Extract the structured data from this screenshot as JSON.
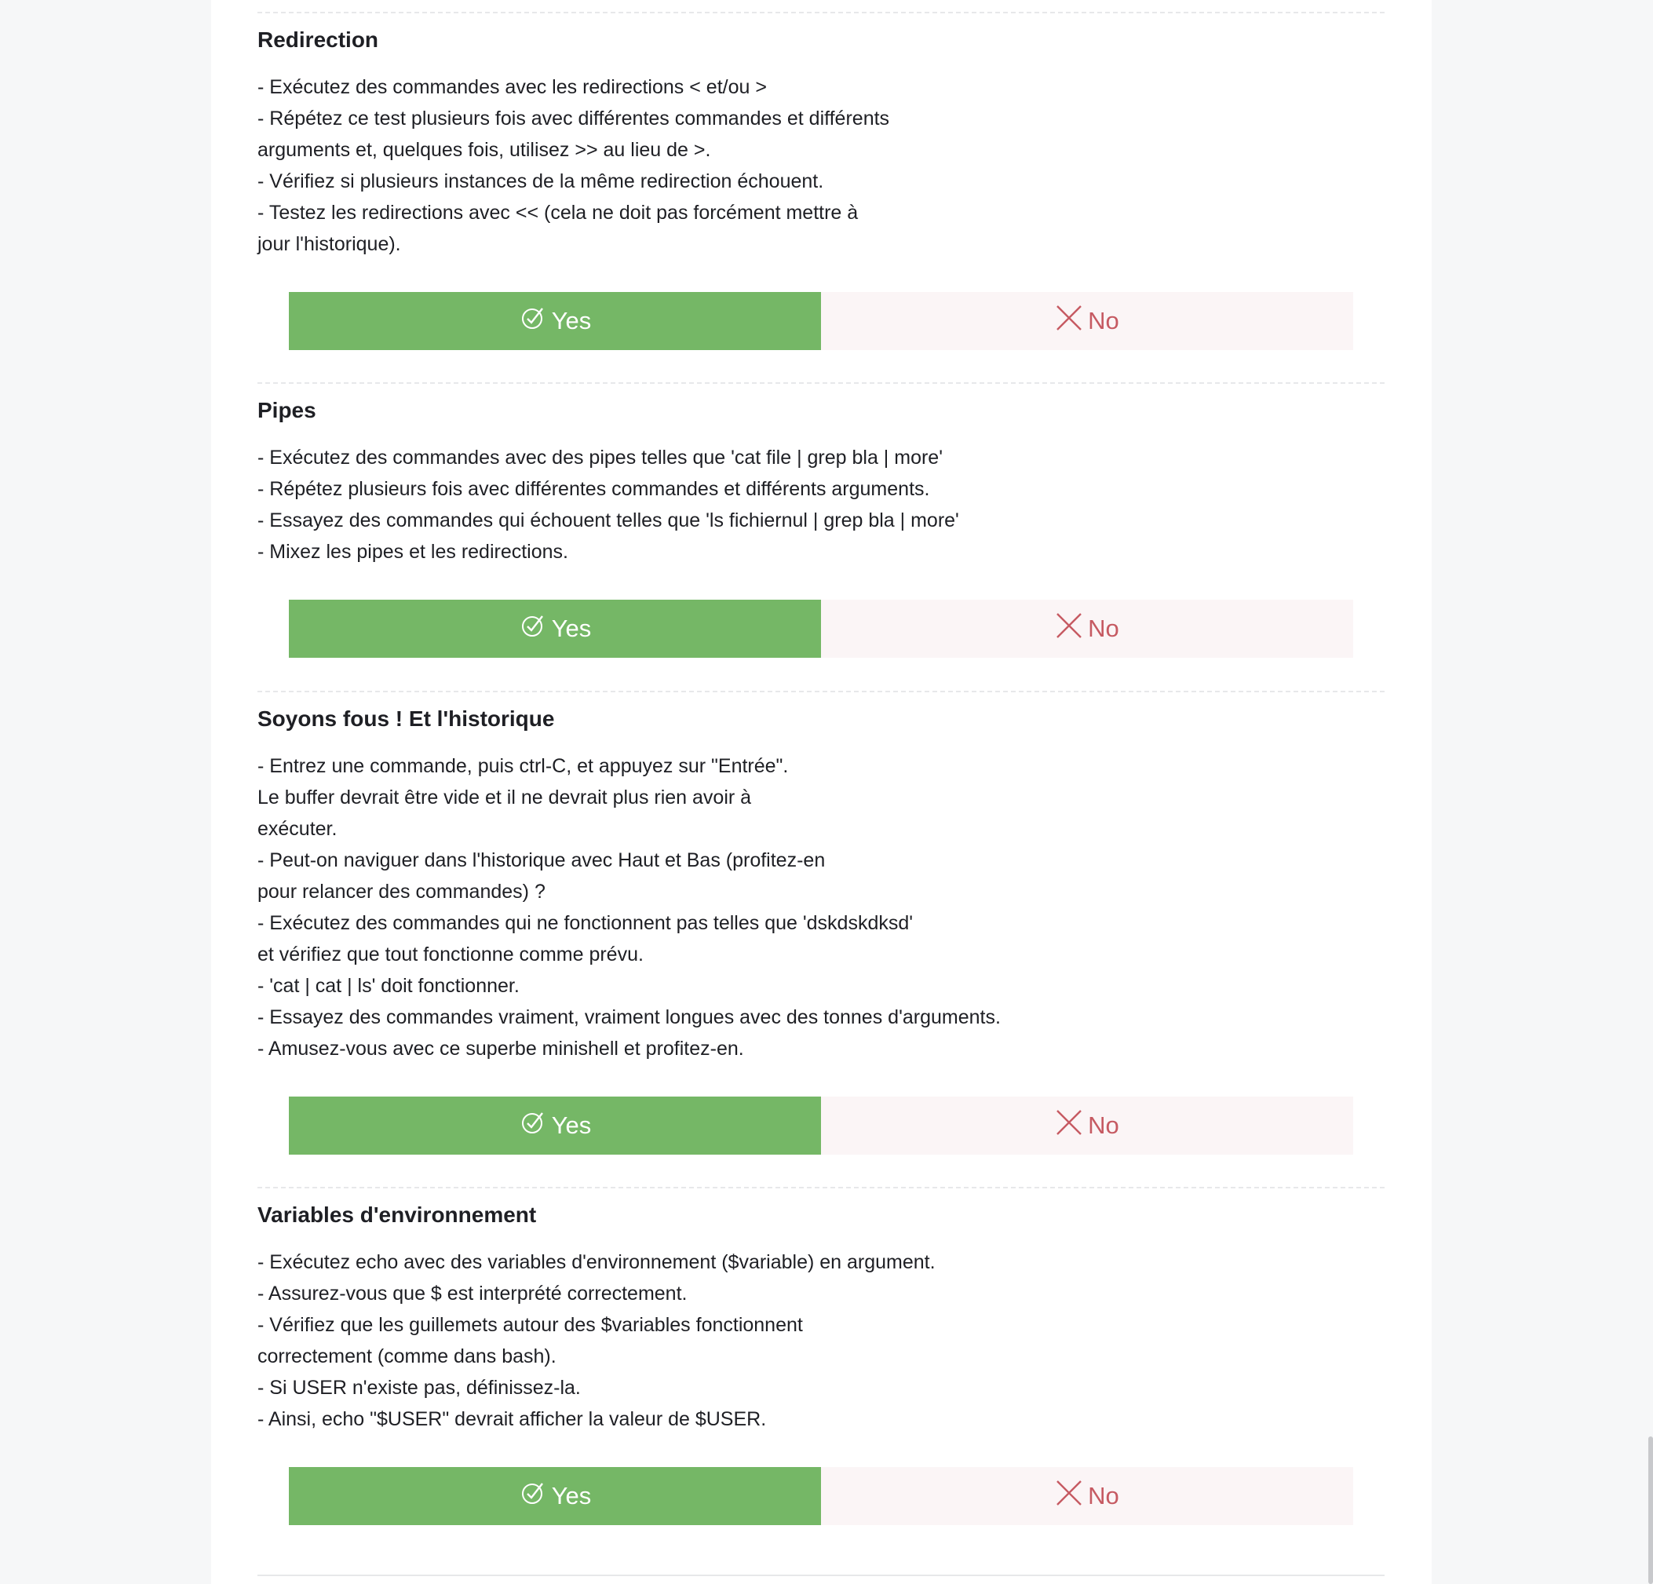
{
  "sections": [
    {
      "title": "Redirection",
      "description": "- Exécutez des commandes avec les redirections < et/ou >\n- Répétez ce test plusieurs fois avec différentes commandes et différents\narguments et, quelques fois, utilisez >> au lieu de >.\n- Vérifiez si plusieurs instances de la même redirection échouent.\n- Testez les redirections avec << (cela ne doit pas forcément mettre à\njour l'historique).",
      "yes_label": "Yes",
      "no_label": "No"
    },
    {
      "title": "Pipes",
      "description": "- Exécutez des commandes avec des pipes telles que 'cat file | grep bla | more'\n- Répétez plusieurs fois avec différentes commandes et différents arguments.\n- Essayez des commandes qui échouent telles que 'ls fichiernul | grep bla | more'\n- Mixez les pipes et les redirections.",
      "yes_label": "Yes",
      "no_label": "No"
    },
    {
      "title": "Soyons fous ! Et l'historique",
      "description": "- Entrez une commande, puis ctrl-C, et appuyez sur \"Entrée\".\nLe buffer devrait être vide et il ne devrait plus rien avoir à\nexécuter.\n- Peut-on naviguer dans l'historique avec Haut et Bas (profitez-en\npour relancer des commandes) ?\n- Exécutez des commandes qui ne fonctionnent pas telles que 'dskdskdksd'\net vérifiez que tout fonctionne comme prévu.\n- 'cat | cat | ls' doit fonctionner.\n- Essayez des commandes vraiment, vraiment longues avec des tonnes d'arguments.\n- Amusez-vous avec ce superbe minishell et profitez-en.",
      "yes_label": "Yes",
      "no_label": "No"
    },
    {
      "title": "Variables d'environnement",
      "description": "- Exécutez echo avec des variables d'environnement ($variable) en argument.\n- Assurez-vous que $ est interprété correctement.\n- Vérifiez que les guillemets autour des $variables fonctionnent\ncorrectement (comme dans bash).\n- Si USER n'existe pas, définissez-la.\n- Ainsi, echo \"$USER\" devrait afficher la valeur de $USER.",
      "yes_label": "Yes",
      "no_label": "No"
    }
  ],
  "colors": {
    "yes_bg": "#75b766",
    "no_bg": "#fbf5f6",
    "no_text": "#c65a62"
  },
  "icons": {
    "yes": "check-circle-icon",
    "no": "x-mark-icon"
  }
}
